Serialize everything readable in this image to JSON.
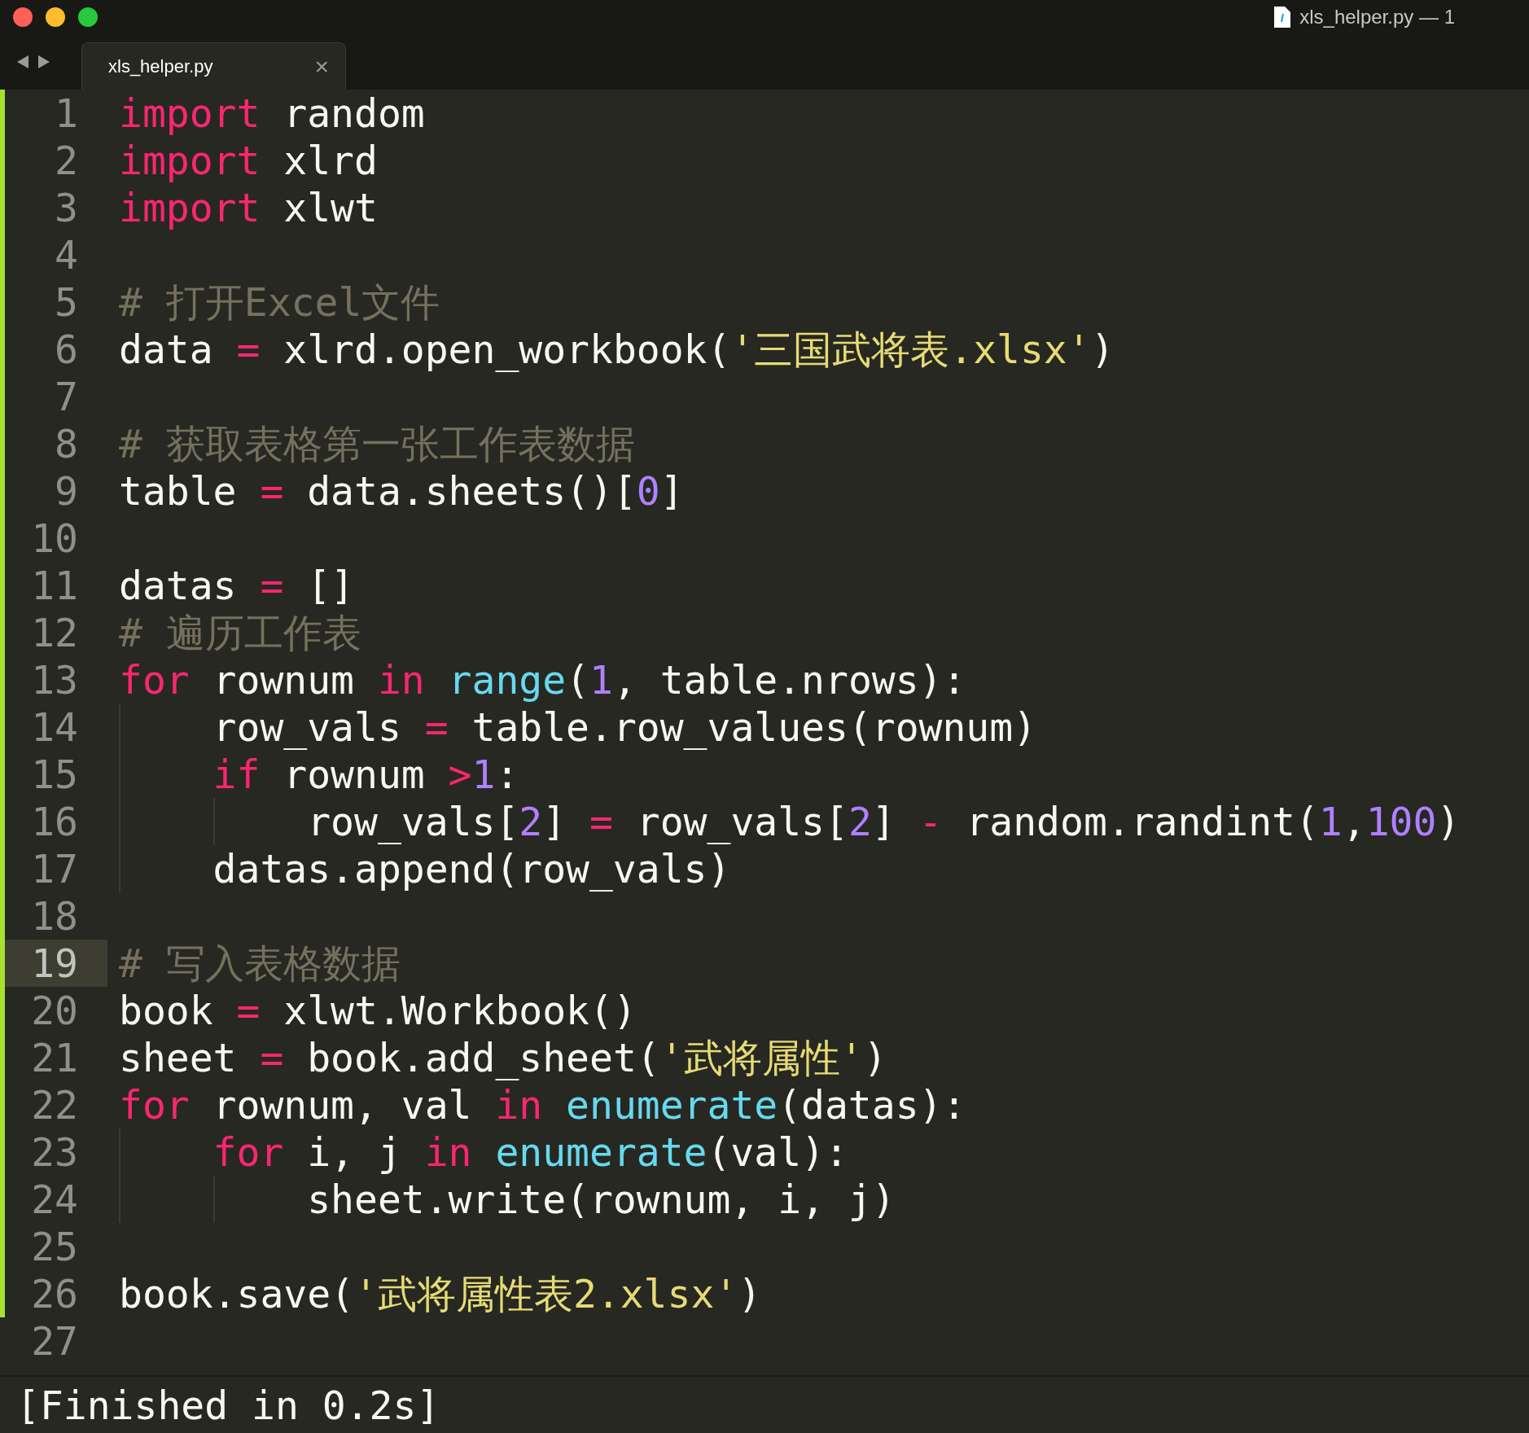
{
  "window": {
    "title": "xls_helper.py — 1"
  },
  "tabs": [
    {
      "label": "xls_helper.py",
      "selected": true,
      "close": "×"
    }
  ],
  "lines": [
    {
      "number": "1",
      "selected": false,
      "modified": true,
      "tokens": [
        {
          "kind": "keyword",
          "text": "import"
        },
        {
          "kind": "plain",
          "text": " random"
        }
      ]
    },
    {
      "number": "2",
      "selected": false,
      "modified": true,
      "tokens": [
        {
          "kind": "keyword",
          "text": "import"
        },
        {
          "kind": "plain",
          "text": " xlrd"
        }
      ]
    },
    {
      "number": "3",
      "selected": false,
      "modified": true,
      "tokens": [
        {
          "kind": "keyword",
          "text": "import"
        },
        {
          "kind": "plain",
          "text": " xlwt"
        }
      ]
    },
    {
      "number": "4",
      "selected": false,
      "modified": true
    },
    {
      "number": "5",
      "selected": false,
      "modified": true,
      "tokens": [
        {
          "kind": "comment",
          "text": "# 打开Excel文件"
        }
      ]
    },
    {
      "number": "6",
      "selected": false,
      "modified": true,
      "tokens": [
        {
          "kind": "plain",
          "text": "data "
        },
        {
          "kind": "operator",
          "text": "="
        },
        {
          "kind": "plain",
          "text": " xlrd.open_workbook("
        },
        {
          "kind": "string",
          "text": "'三国武将表.xlsx'"
        },
        {
          "kind": "plain",
          "text": ")"
        }
      ]
    },
    {
      "number": "7",
      "selected": false,
      "modified": true
    },
    {
      "number": "8",
      "selected": false,
      "modified": true,
      "tokens": [
        {
          "kind": "comment",
          "text": "# 获取表格第一张工作表数据"
        }
      ]
    },
    {
      "number": "9",
      "selected": false,
      "modified": true,
      "tokens": [
        {
          "kind": "plain",
          "text": "table "
        },
        {
          "kind": "operator",
          "text": "="
        },
        {
          "kind": "plain",
          "text": " data.sheets()["
        },
        {
          "kind": "number",
          "text": "0"
        },
        {
          "kind": "plain",
          "text": "]"
        }
      ]
    },
    {
      "number": "10",
      "selected": false,
      "modified": true
    },
    {
      "number": "11",
      "selected": false,
      "modified": true,
      "tokens": [
        {
          "kind": "plain",
          "text": "datas "
        },
        {
          "kind": "operator",
          "text": "="
        },
        {
          "kind": "plain",
          "text": " []"
        }
      ]
    },
    {
      "number": "12",
      "selected": false,
      "modified": true,
      "tokens": [
        {
          "kind": "comment",
          "text": "# 遍历工作表"
        }
      ]
    },
    {
      "number": "13",
      "selected": false,
      "modified": true,
      "tokens": [
        {
          "kind": "keyword",
          "text": "for"
        },
        {
          "kind": "plain",
          "text": " rownum "
        },
        {
          "kind": "keyword",
          "text": "in"
        },
        {
          "kind": "builtin",
          "text": " range"
        },
        {
          "kind": "plain",
          "text": "("
        },
        {
          "kind": "number",
          "text": "1"
        },
        {
          "kind": "plain",
          "text": ", table.nrows):"
        }
      ]
    },
    {
      "number": "14",
      "selected": false,
      "modified": true,
      "tokens": [
        {
          "kind": "plain",
          "text": "    row_vals "
        },
        {
          "kind": "operator",
          "text": "="
        },
        {
          "kind": "plain",
          "text": " table.row_values(rownum)"
        }
      ]
    },
    {
      "number": "15",
      "selected": false,
      "modified": true,
      "tokens": [
        {
          "kind": "keyword",
          "text": "    if"
        },
        {
          "kind": "plain",
          "text": " rownum "
        },
        {
          "kind": "operator",
          "text": ">"
        },
        {
          "kind": "number",
          "text": "1"
        },
        {
          "kind": "plain",
          "text": ":"
        }
      ]
    },
    {
      "number": "16",
      "selected": false,
      "modified": true,
      "tokens": [
        {
          "kind": "plain",
          "text": "        row_vals["
        },
        {
          "kind": "number",
          "text": "2"
        },
        {
          "kind": "plain",
          "text": "] "
        },
        {
          "kind": "operator",
          "text": "="
        },
        {
          "kind": "plain",
          "text": " row_vals["
        },
        {
          "kind": "number",
          "text": "2"
        },
        {
          "kind": "plain",
          "text": "] "
        },
        {
          "kind": "operator",
          "text": "-"
        },
        {
          "kind": "plain",
          "text": " random.randint("
        },
        {
          "kind": "number",
          "text": "1"
        },
        {
          "kind": "plain",
          "text": ","
        },
        {
          "kind": "number",
          "text": "100"
        },
        {
          "kind": "plain",
          "text": ")"
        }
      ]
    },
    {
      "number": "17",
      "selected": false,
      "modified": true,
      "tokens": [
        {
          "kind": "plain",
          "text": "    datas.append(row_vals)"
        }
      ]
    },
    {
      "number": "18",
      "selected": false,
      "modified": true
    },
    {
      "number": "19",
      "selected": true,
      "modified": true,
      "tokens": [
        {
          "kind": "comment",
          "text": "# 写入表格数据"
        }
      ]
    },
    {
      "number": "20",
      "selected": false,
      "modified": true,
      "tokens": [
        {
          "kind": "plain",
          "text": "book "
        },
        {
          "kind": "operator",
          "text": "="
        },
        {
          "kind": "plain",
          "text": " xlwt.Workbook()"
        }
      ]
    },
    {
      "number": "21",
      "selected": false,
      "modified": true,
      "tokens": [
        {
          "kind": "plain",
          "text": "sheet "
        },
        {
          "kind": "operator",
          "text": "="
        },
        {
          "kind": "plain",
          "text": " book.add_sheet("
        },
        {
          "kind": "string",
          "text": "'武将属性'"
        },
        {
          "kind": "plain",
          "text": ")"
        }
      ]
    },
    {
      "number": "22",
      "selected": false,
      "modified": true,
      "tokens": [
        {
          "kind": "keyword",
          "text": "for"
        },
        {
          "kind": "plain",
          "text": " rownum, val "
        },
        {
          "kind": "keyword",
          "text": "in"
        },
        {
          "kind": "builtin",
          "text": " enumerate"
        },
        {
          "kind": "plain",
          "text": "(datas):"
        }
      ]
    },
    {
      "number": "23",
      "selected": false,
      "modified": true,
      "tokens": [
        {
          "kind": "keyword",
          "text": "    for"
        },
        {
          "kind": "plain",
          "text": " i, j "
        },
        {
          "kind": "keyword",
          "text": "in"
        },
        {
          "kind": "builtin",
          "text": " enumerate"
        },
        {
          "kind": "plain",
          "text": "(val):"
        }
      ]
    },
    {
      "number": "24",
      "selected": false,
      "modified": true,
      "tokens": [
        {
          "kind": "plain",
          "text": "        sheet.write(rownum, i, j)"
        }
      ]
    },
    {
      "number": "25",
      "selected": false,
      "modified": true
    },
    {
      "number": "26",
      "selected": false,
      "modified": true,
      "tokens": [
        {
          "kind": "plain",
          "text": "book.save("
        },
        {
          "kind": "string",
          "text": "'武将属性表2.xlsx'"
        },
        {
          "kind": "plain",
          "text": ")"
        }
      ]
    },
    {
      "number": "27",
      "selected": false,
      "modified": false
    }
  ],
  "output": {
    "text": "[Finished in 0.2s]"
  }
}
